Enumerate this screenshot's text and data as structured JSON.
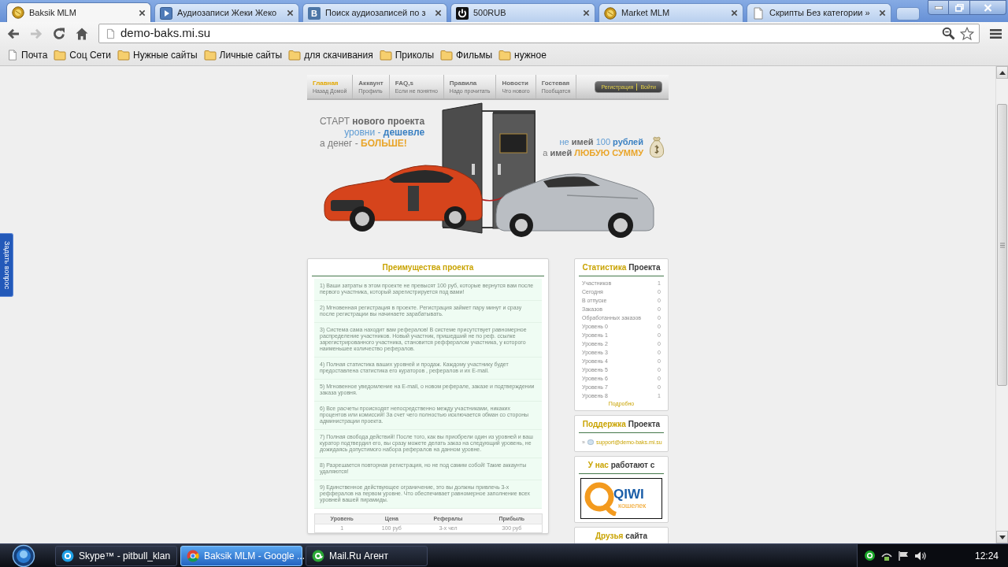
{
  "browser": {
    "tabs": [
      {
        "title": "Baksik MLM",
        "kind": "coin",
        "selected": true
      },
      {
        "title": "Аудиозаписи Жеки Жеко",
        "kind": "play",
        "selected": false
      },
      {
        "title": "Поиск аудиозаписей по з",
        "kind": "letter",
        "glyph": "B",
        "selected": false
      },
      {
        "title": "500RUB",
        "kind": "power",
        "selected": false
      },
      {
        "title": "Market MLM",
        "kind": "coin",
        "selected": false
      },
      {
        "title": "Скрипты Без категории »",
        "kind": "page",
        "selected": false
      }
    ],
    "nav_buttons": [
      {
        "kind": "back",
        "disabled": false
      },
      {
        "kind": "forward",
        "disabled": true
      },
      {
        "kind": "reload",
        "disabled": false
      },
      {
        "kind": "home",
        "disabled": false
      }
    ],
    "address": "demo-baks.mi.su",
    "bookmarks": [
      {
        "label": "Почта",
        "kind": "page"
      },
      {
        "label": "Соц Сети",
        "kind": "folder"
      },
      {
        "label": "Нужные сайты",
        "kind": "folder"
      },
      {
        "label": "Личные сайты",
        "kind": "folder"
      },
      {
        "label": "для скачивания",
        "kind": "folder"
      },
      {
        "label": "Приколы",
        "kind": "folder"
      },
      {
        "label": "Фильмы",
        "kind": "folder"
      },
      {
        "label": "нужное",
        "kind": "folder"
      }
    ]
  },
  "feedback_tab": {
    "label": "Задать вопрос"
  },
  "site": {
    "nav": [
      {
        "title": "Главная",
        "subtitle": "Назад Домой",
        "selected": true
      },
      {
        "title": "Аккаунт",
        "subtitle": "Профиль",
        "selected": false
      },
      {
        "title": "FAQ,s",
        "subtitle": "Если не понятно",
        "selected": false
      },
      {
        "title": "Правила",
        "subtitle": "Надо прочитать",
        "selected": false
      },
      {
        "title": "Новости",
        "subtitle": "Что нового",
        "selected": false
      },
      {
        "title": "Гостевая",
        "subtitle": "Пообщатся",
        "selected": false
      }
    ],
    "auth_links": [
      {
        "label": "Регистрация"
      },
      {
        "label": "Войти"
      }
    ],
    "banner": {
      "left_lines": [
        [
          {
            "text": "СТАРТ",
            "kind": "light"
          },
          {
            "text": "нового проекта",
            "kind": "bold"
          }
        ],
        [
          {
            "text": "уровни -",
            "kind": "blue"
          },
          {
            "text": "дешевле",
            "kind": "blue_bold"
          }
        ],
        [
          {
            "text": "а денег -",
            "kind": "light"
          },
          {
            "text": "БОЛЬШЕ!",
            "kind": "orange_bold"
          }
        ]
      ],
      "right_lines": [
        [
          {
            "text": "не",
            "kind": "blue"
          },
          {
            "text": "имей",
            "kind": "bold"
          },
          {
            "text": "100",
            "kind": "blue"
          },
          {
            "text": "рублей",
            "kind": "blue_bold"
          }
        ],
        [
          {
            "text": "а",
            "kind": "light"
          },
          {
            "text": "имей",
            "kind": "bold"
          },
          {
            "text": "ЛЮБУЮ СУММУ",
            "kind": "orange_bold"
          }
        ]
      ]
    },
    "advantages": {
      "title": "Преимущества проекта",
      "items": [
        "1) Ваши затраты в этом проекте не превысят 100 руб, которые вернутся вам после первого участника, который зарегистрируется под вами!",
        "2) Мгновенная регистрация в проекте. Регистрация займет пару минут и сразу после регистрации вы начинаете зарабатывать.",
        "3) Система сама находит вам рефералов! В системе присутствует равномерное распределение участников. Новый участник, пришедший не по реф. ссылке зарегистрированного участника, становится реффералом участника, у которого наименьшее количество рефералов.",
        "4) Полная статистика ваших уровней и продаж. Каждому участнику будет предоставлена статистика его кураторов , рефералов и их E-mail.",
        "5) Мгновенное уведомление на E-mail, о новом реферале, заказе и подтверждении заказа уровня.",
        "6) Все расчеты происходят непосредственно между участниками, никаких процентов или комиссий! За счет чего полностью исключается обман со стороны администрации проекта.",
        "7) Полная свобода действий! После того, как вы приобрели один из уровней и ваш куратор подтвердил его, вы сразу можете делать заказ на следующий уровень, не дожидаясь допустимого набора рефералов на данном уровне.",
        "8) Разрешается повторная регистрация, но не под самим собой! Такие аккаунты удаляются!",
        "9) Единственное действующее ограничение, это вы должны привлечь 3-х реффералов на первом уровне. Что обеспечивает равномерное заполнение всех уровней вашей пирамиды."
      ],
      "table": {
        "columns": [
          "Уровень",
          "Цена",
          "Рефералы",
          "Прибыль"
        ],
        "rows": [
          [
            "1",
            "100 руб",
            "3-х чел",
            "300 руб"
          ]
        ]
      }
    },
    "stats": {
      "title": {
        "accent": "Статистика",
        "rest": "Проекта"
      },
      "rows": [
        {
          "label": "Участников",
          "value": "1"
        },
        {
          "label": "Сегодня",
          "value": "0"
        },
        {
          "label": "В отпуске",
          "value": "0"
        },
        {
          "label": "Заказов",
          "value": "0"
        },
        {
          "label": "Обработанных заказов",
          "value": "0"
        },
        {
          "label": "Уровень 0",
          "value": "0"
        },
        {
          "label": "Уровень 1",
          "value": "0"
        },
        {
          "label": "Уровень 2",
          "value": "0"
        },
        {
          "label": "Уровень 3",
          "value": "0"
        },
        {
          "label": "Уровень 4",
          "value": "0"
        },
        {
          "label": "Уровень 5",
          "value": "0"
        },
        {
          "label": "Уровень 6",
          "value": "0"
        },
        {
          "label": "Уровень 7",
          "value": "0"
        },
        {
          "label": "Уровень 8",
          "value": "1"
        }
      ],
      "more_link": "Подробно"
    },
    "support": {
      "title": {
        "accent": "Поддержка",
        "rest": "Проекта"
      },
      "marker": "»",
      "email": "support@demo-baks.mi.su"
    },
    "partners": {
      "title": {
        "accent": "У нас",
        "rest": "работают с"
      },
      "logo": {
        "name": "QIWI",
        "caption": "кошелек"
      }
    },
    "friends": {
      "title": {
        "accent": "Друзья",
        "rest": "сайта"
      }
    }
  },
  "taskbar": {
    "buttons": [
      {
        "label": "Skype™ - pitbull_klan",
        "kind": "skype",
        "selected": false
      },
      {
        "label": "Baksik MLM - Google ...",
        "kind": "chrome",
        "selected": true
      },
      {
        "label": "Mail.Ru Агент",
        "kind": "mail",
        "selected": false
      }
    ],
    "clock": "12:24"
  }
}
